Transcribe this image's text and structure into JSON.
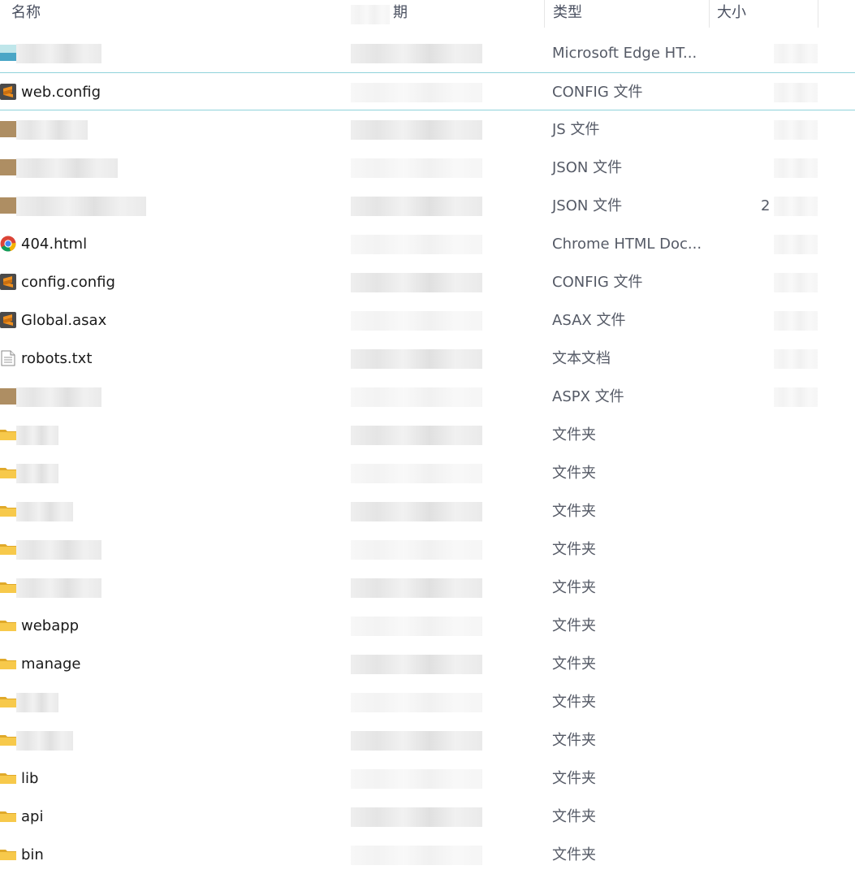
{
  "columns": {
    "name": "名称",
    "date": "期",
    "type": "类型",
    "size": "大小"
  },
  "rows": [
    {
      "name": "",
      "type": "Microsoft Edge HT...",
      "icon": "blurred-icon",
      "selected": false
    },
    {
      "name": "web.config",
      "type": "CONFIG 文件",
      "icon": "sublime-file-icon",
      "selected": true
    },
    {
      "name": "",
      "type": "JS 文件",
      "icon": "blurred-icon",
      "selected": false
    },
    {
      "name": "",
      "type": "JSON 文件",
      "icon": "blurred-icon",
      "selected": false
    },
    {
      "name": "",
      "type": "JSON 文件",
      "icon": "blurred-icon",
      "selected": false
    },
    {
      "name": "404.html",
      "type": "Chrome HTML Doc...",
      "icon": "chrome-icon",
      "selected": false
    },
    {
      "name": "config.config",
      "type": "CONFIG 文件",
      "icon": "sublime-file-icon",
      "selected": false
    },
    {
      "name": "Global.asax",
      "type": "ASAX 文件",
      "icon": "sublime-file-icon",
      "selected": false
    },
    {
      "name": "robots.txt",
      "type": "文本文档",
      "icon": "text-file-icon",
      "selected": false
    },
    {
      "name": "",
      "type": "ASPX 文件",
      "icon": "blurred-icon",
      "selected": false
    },
    {
      "name": "",
      "type": "文件夹",
      "icon": "folder-icon",
      "selected": false
    },
    {
      "name": "",
      "type": "文件夹",
      "icon": "folder-icon",
      "selected": false
    },
    {
      "name": "",
      "type": "文件夹",
      "icon": "folder-icon",
      "selected": false
    },
    {
      "name": "",
      "type": "文件夹",
      "icon": "folder-icon",
      "selected": false
    },
    {
      "name": "",
      "type": "文件夹",
      "icon": "folder-icon",
      "selected": false
    },
    {
      "name": "webapp",
      "type": "文件夹",
      "icon": "folder-icon",
      "selected": false
    },
    {
      "name": "manage",
      "type": "文件夹",
      "icon": "folder-icon",
      "selected": false
    },
    {
      "name": "",
      "type": "文件夹",
      "icon": "folder-icon",
      "selected": false
    },
    {
      "name": "",
      "type": "文件夹",
      "icon": "folder-icon",
      "selected": false
    },
    {
      "name": "lib",
      "type": "文件夹",
      "icon": "folder-icon",
      "selected": false
    },
    {
      "name": "api",
      "type": "文件夹",
      "icon": "folder-icon",
      "selected": false
    },
    {
      "name": "bin",
      "type": "文件夹",
      "icon": "folder-icon",
      "selected": false
    }
  ],
  "size_fragment": "2",
  "colors": {
    "header_text": "#4a5060",
    "type_text": "#555a66",
    "selection_border": "#8fd3db",
    "folder": "#f5c544",
    "sublime": "#f0901e"
  }
}
